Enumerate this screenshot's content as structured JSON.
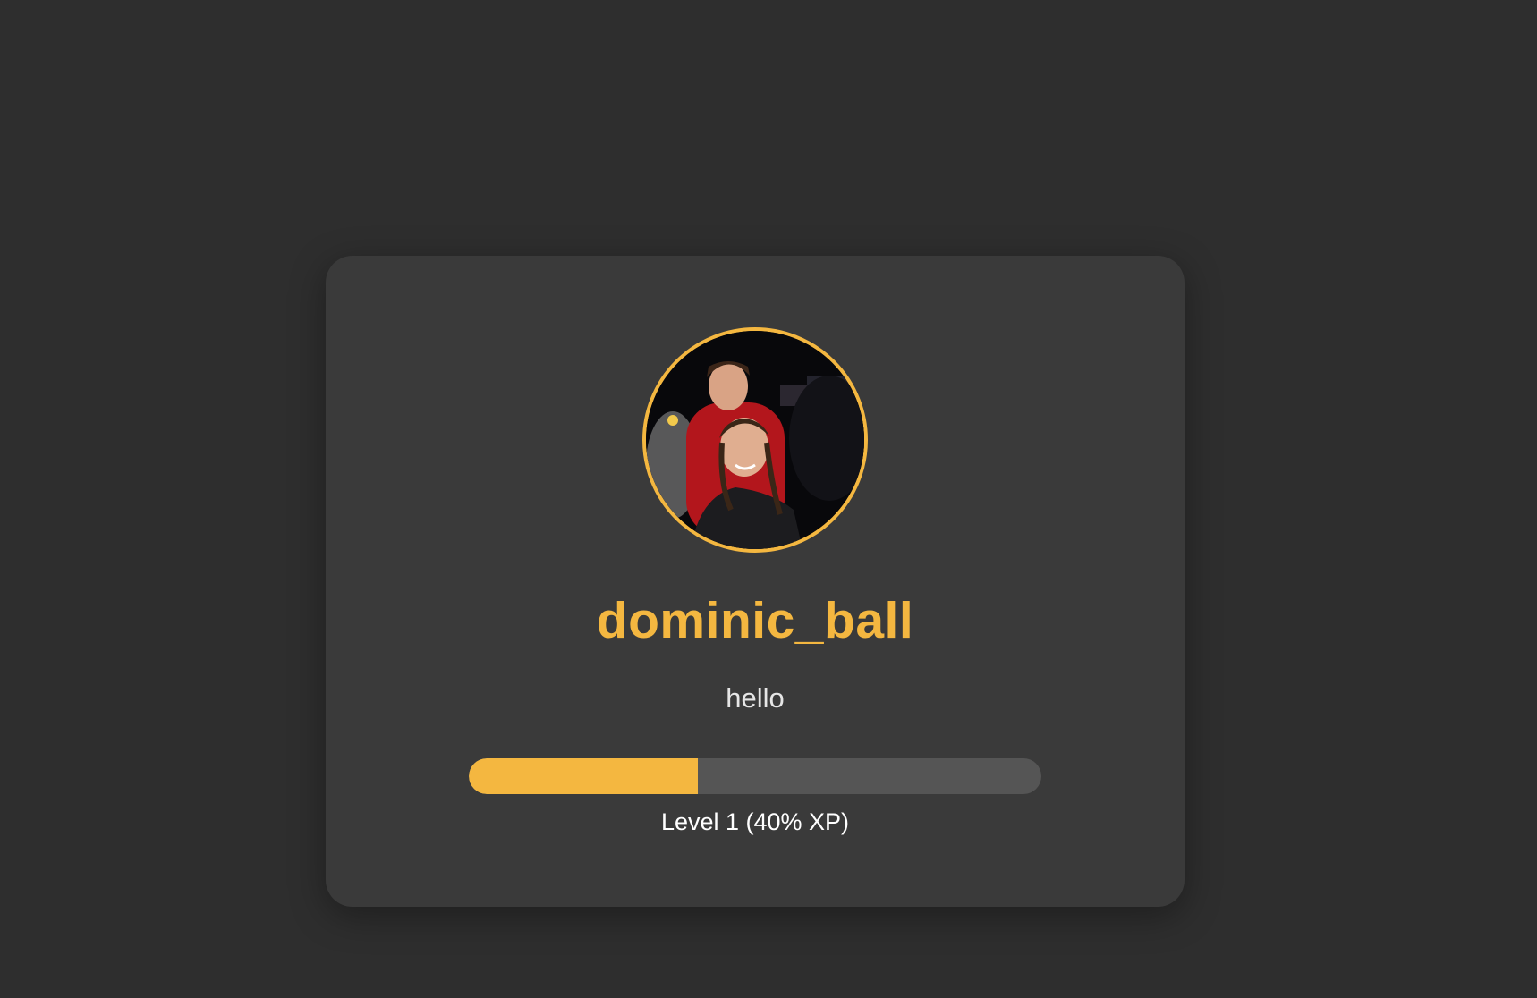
{
  "profile": {
    "username": "dominic_ball",
    "bio": "hello",
    "avatar_icon": "profile-photo",
    "level_text": "Level 1 (40% XP)",
    "xp_progress": 0.4
  },
  "colors": {
    "background": "#2e2e2e",
    "card": "#3a3a3a",
    "accent": "#f4b740",
    "track": "#555555",
    "text": "#ffffff"
  }
}
